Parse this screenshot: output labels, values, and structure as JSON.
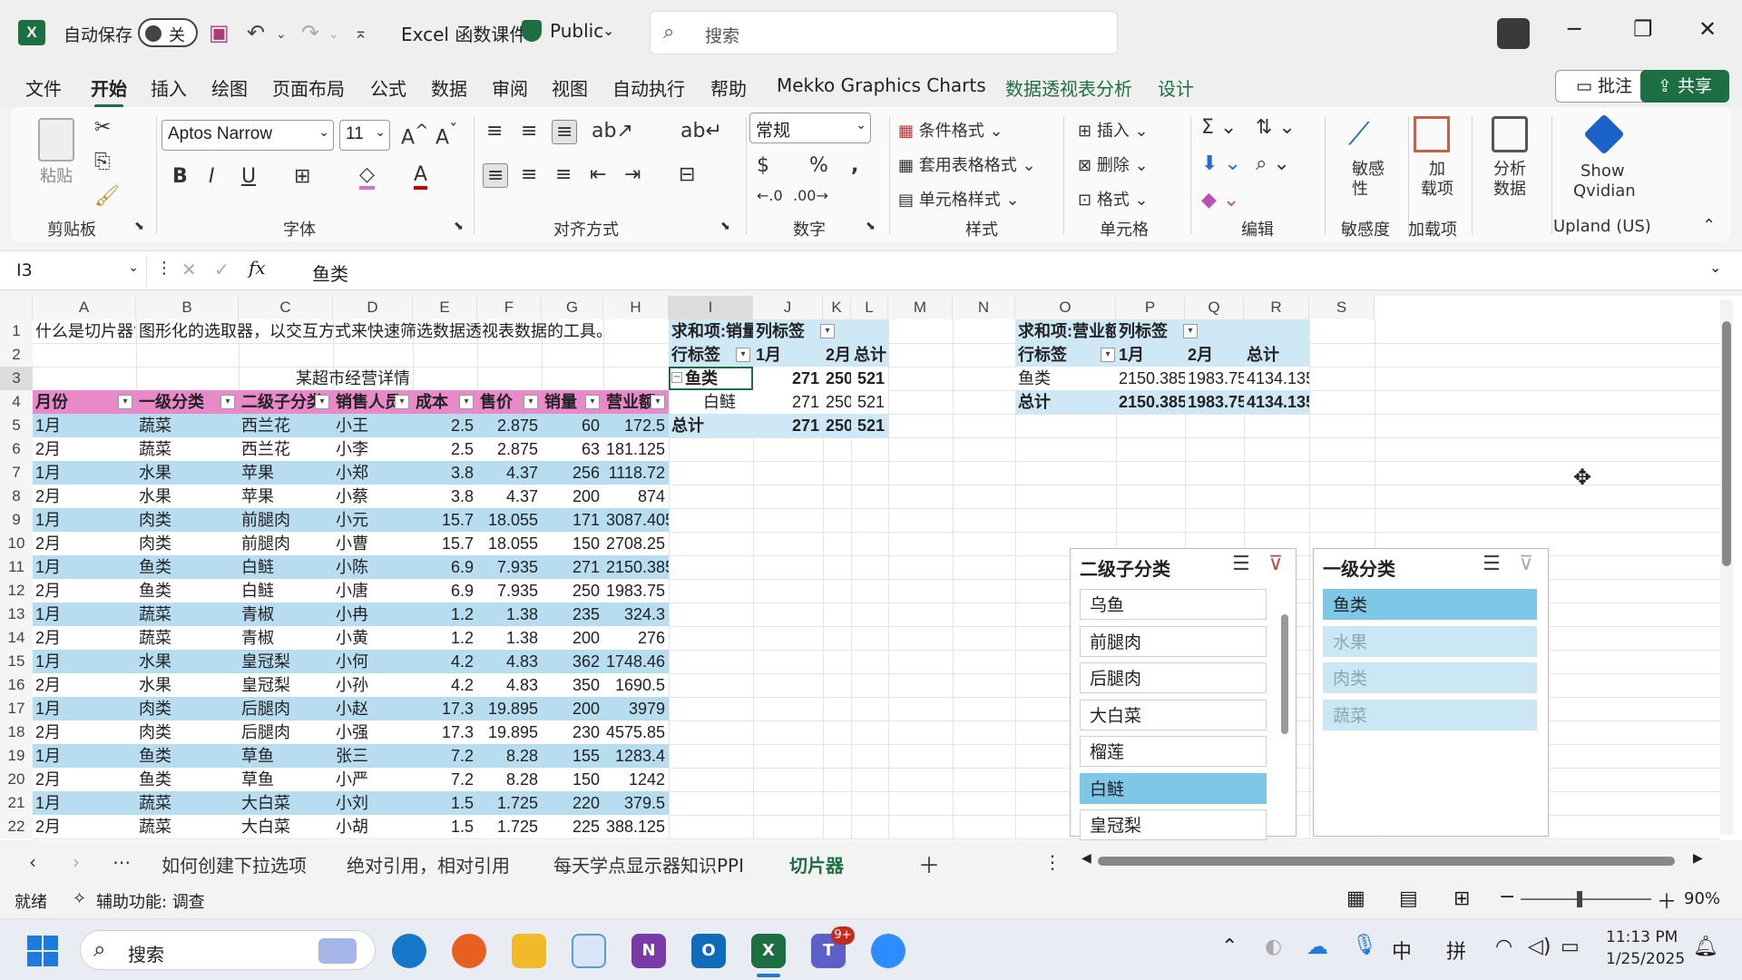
{
  "titlebar": {
    "logo": "X",
    "autosave_label": "自动保存",
    "toggle_state": "关",
    "file_title": "Excel 函数课件",
    "visibility": "Public",
    "search_placeholder": "搜索"
  },
  "menu": {
    "items": [
      "文件",
      "开始",
      "插入",
      "绘图",
      "页面布局",
      "公式",
      "数据",
      "审阅",
      "视图",
      "自动执行",
      "帮助",
      "Mekko Graphics Charts",
      "数据透视表分析",
      "设计"
    ],
    "comment": "批注",
    "share": "共享"
  },
  "ribbon": {
    "clipboard": {
      "paste": "粘贴",
      "label": "剪贴板"
    },
    "font": {
      "name": "Aptos Narrow",
      "size": "11",
      "label": "字体"
    },
    "align": {
      "label": "对齐方式"
    },
    "number": {
      "format": "常规",
      "label": "数字"
    },
    "styles": {
      "cond": "条件格式",
      "table": "套用表格格式",
      "cell": "单元格样式",
      "label": "样式"
    },
    "cells": {
      "insert": "插入",
      "delete": "删除",
      "format": "格式",
      "label": "单元格"
    },
    "edit": {
      "label": "编辑"
    },
    "sens": {
      "btn": "敏感\n性",
      "label": "敏感度"
    },
    "addin": {
      "btn": "加\n载项",
      "label": "加载项"
    },
    "analyze": {
      "btn": "分析\n数据"
    },
    "qvidian": {
      "btn1": "Show",
      "btn2": "Qvidian",
      "label": "Upland (US)"
    }
  },
  "formula": {
    "namebox": "I3",
    "content": "鱼类"
  },
  "columns": [
    "A",
    "B",
    "C",
    "D",
    "E",
    "F",
    "G",
    "H",
    "I",
    "J",
    "K",
    "L",
    "M",
    "N",
    "O",
    "P",
    "Q",
    "R",
    "S"
  ],
  "row1": {
    "a": "什么是切片器?",
    "b": "图形化的选取器，以交互方式来快速筛选数据透视表数据的工具。"
  },
  "row3_title": "某超市经营详情",
  "table": {
    "headers": [
      "月份",
      "一级分类",
      "二级子分类",
      "销售人员",
      "成本",
      "售价",
      "销量",
      "营业额"
    ],
    "rows": [
      [
        "1月",
        "蔬菜",
        "西兰花",
        "小王",
        "2.5",
        "2.875",
        "60",
        "172.5"
      ],
      [
        "2月",
        "蔬菜",
        "西兰花",
        "小李",
        "2.5",
        "2.875",
        "63",
        "181.125"
      ],
      [
        "1月",
        "水果",
        "苹果",
        "小郑",
        "3.8",
        "4.37",
        "256",
        "1118.72"
      ],
      [
        "2月",
        "水果",
        "苹果",
        "小蔡",
        "3.8",
        "4.37",
        "200",
        "874"
      ],
      [
        "1月",
        "肉类",
        "前腿肉",
        "小元",
        "15.7",
        "18.055",
        "171",
        "3087.405"
      ],
      [
        "2月",
        "肉类",
        "前腿肉",
        "小曹",
        "15.7",
        "18.055",
        "150",
        "2708.25"
      ],
      [
        "1月",
        "鱼类",
        "白鲢",
        "小陈",
        "6.9",
        "7.935",
        "271",
        "2150.385"
      ],
      [
        "2月",
        "鱼类",
        "白鲢",
        "小唐",
        "6.9",
        "7.935",
        "250",
        "1983.75"
      ],
      [
        "1月",
        "蔬菜",
        "青椒",
        "小冉",
        "1.2",
        "1.38",
        "235",
        "324.3"
      ],
      [
        "2月",
        "蔬菜",
        "青椒",
        "小黄",
        "1.2",
        "1.38",
        "200",
        "276"
      ],
      [
        "1月",
        "水果",
        "皇冠梨",
        "小何",
        "4.2",
        "4.83",
        "362",
        "1748.46"
      ],
      [
        "2月",
        "水果",
        "皇冠梨",
        "小孙",
        "4.2",
        "4.83",
        "350",
        "1690.5"
      ],
      [
        "1月",
        "肉类",
        "后腿肉",
        "小赵",
        "17.3",
        "19.895",
        "200",
        "3979"
      ],
      [
        "2月",
        "肉类",
        "后腿肉",
        "小强",
        "17.3",
        "19.895",
        "230",
        "4575.85"
      ],
      [
        "1月",
        "鱼类",
        "草鱼",
        "张三",
        "7.2",
        "8.28",
        "155",
        "1283.4"
      ],
      [
        "2月",
        "鱼类",
        "草鱼",
        "小严",
        "7.2",
        "8.28",
        "150",
        "1242"
      ],
      [
        "1月",
        "蔬菜",
        "大白菜",
        "小刘",
        "1.5",
        "1.725",
        "220",
        "379.5"
      ],
      [
        "2月",
        "蔬菜",
        "大白菜",
        "小胡",
        "1.5",
        "1.725",
        "225",
        "388.125"
      ]
    ]
  },
  "pivot1": {
    "title": "求和项:销量",
    "col_label": "列标签",
    "row_label": "行标签",
    "m1": "1月",
    "m2": "2月",
    "total": "总计",
    "group": "鱼类",
    "item": "白鲢",
    "g_vals": [
      "271",
      "250",
      "521"
    ],
    "i_vals": [
      "271",
      "250",
      "521"
    ],
    "t_vals": [
      "271",
      "250",
      "521"
    ]
  },
  "pivot2": {
    "title": "求和项:营业额",
    "col_label": "列标签",
    "row_label": "行标签",
    "m1": "1月",
    "m2": "2月",
    "total": "总计",
    "item": "鱼类",
    "i_vals": [
      "2150.385",
      "1983.75",
      "4134.135"
    ],
    "t_vals": [
      "2150.385",
      "1983.75",
      "4134.135"
    ]
  },
  "slicer1": {
    "title": "二级子分类",
    "items": [
      "乌鱼",
      "前腿肉",
      "后腿肉",
      "大白菜",
      "榴莲",
      "白鲢",
      "皇冠梨"
    ]
  },
  "slicer2": {
    "title": "一级分类",
    "items": [
      "鱼类",
      "水果",
      "肉类",
      "蔬菜"
    ]
  },
  "tabs": [
    "如何创建下拉选项",
    "绝对引用，相对引用",
    "每天学点显示器知识PPI",
    "切片器"
  ],
  "status": {
    "ready": "就绪",
    "access": "辅助功能: 调查",
    "zoom": "90%"
  },
  "taskbar": {
    "search": "搜索",
    "ime1": "中",
    "ime2": "拼",
    "time": "11:13 PM",
    "date": "1/25/2025",
    "badge": "9+"
  }
}
